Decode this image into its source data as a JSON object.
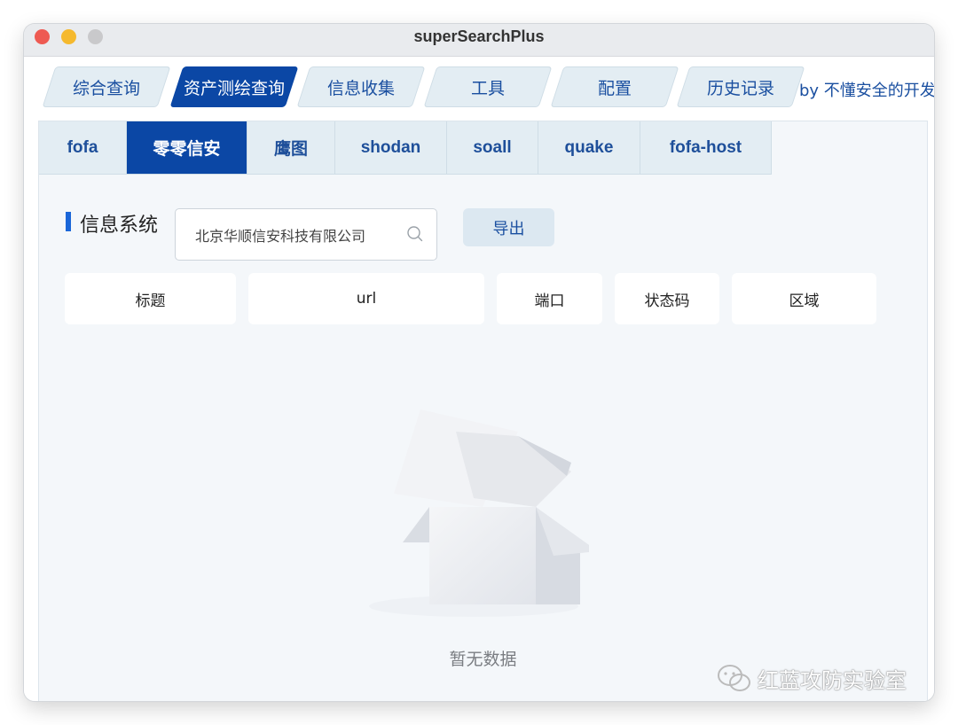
{
  "window": {
    "title": "superSearchPlus"
  },
  "main_tabs": [
    {
      "label": "综合查询",
      "active": false
    },
    {
      "label": "资产测绘查询",
      "active": true
    },
    {
      "label": "信息收集",
      "active": false
    },
    {
      "label": "工具",
      "active": false
    },
    {
      "label": "配置",
      "active": false
    },
    {
      "label": "历史记录",
      "active": false
    }
  ],
  "byline": "by 不懂安全的开发",
  "sub_tabs": [
    {
      "label": "fofa",
      "active": false
    },
    {
      "label": "零零信安",
      "active": true
    },
    {
      "label": "鹰图",
      "active": false
    },
    {
      "label": "shodan",
      "active": false
    },
    {
      "label": "soall",
      "active": false
    },
    {
      "label": "quake",
      "active": false
    },
    {
      "label": "fofa-host",
      "active": false
    }
  ],
  "section": {
    "title": "信息系统"
  },
  "search": {
    "value": "北京华顺信安科技有限公司",
    "placeholder": ""
  },
  "export_label": "导出",
  "columns": [
    "标题",
    "url",
    "端口",
    "状态码",
    "区域"
  ],
  "empty_state": "暂无数据",
  "watermark": "红蓝攻防实验室",
  "colors": {
    "accent": "#0b47a5",
    "tab_bg": "#e3edf3",
    "panel_bg": "#f4f7fa"
  }
}
